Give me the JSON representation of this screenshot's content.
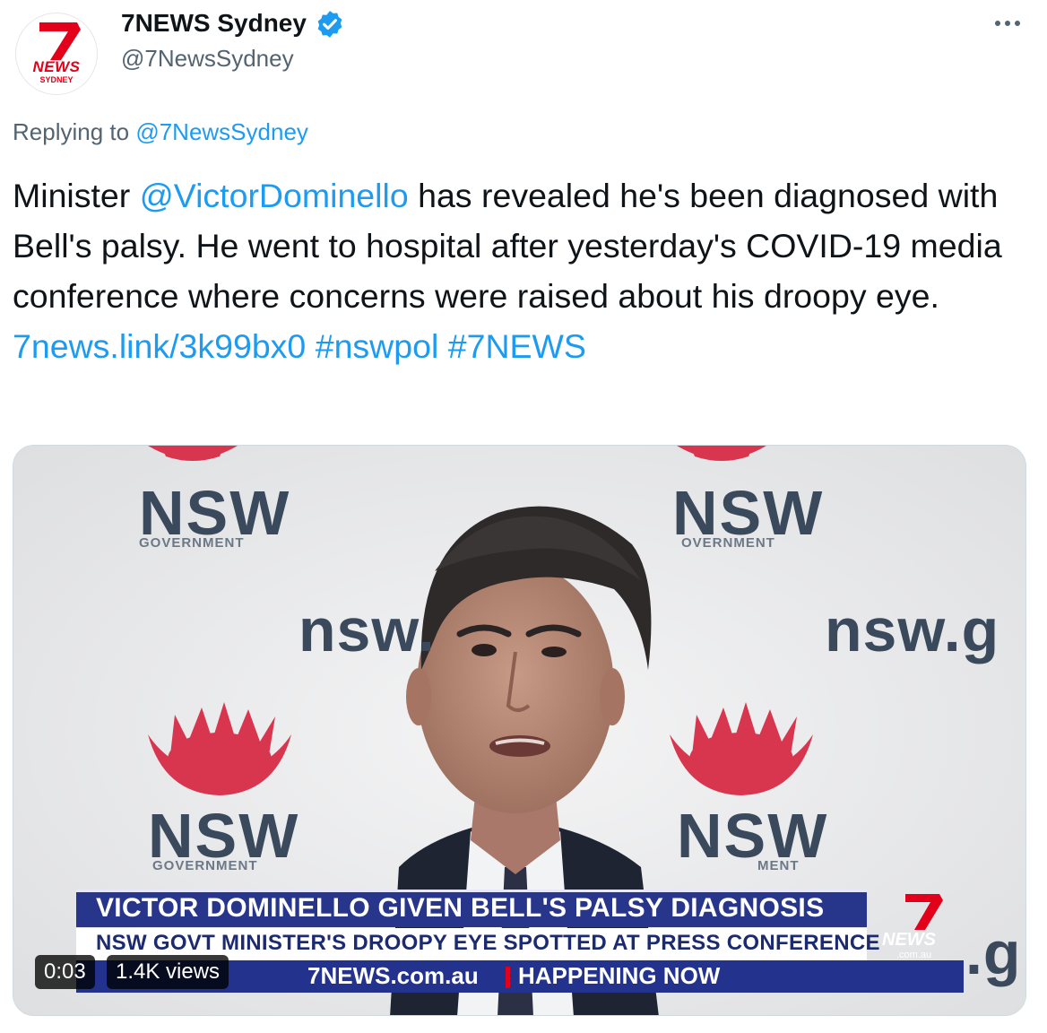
{
  "author": {
    "display_name": "7NEWS Sydney",
    "handle": "@7NewsSydney",
    "verified": true,
    "avatar": {
      "logo_number": "7",
      "logo_word": "NEWS",
      "logo_city": "SYDNEY"
    }
  },
  "menu": {
    "icon": "more-horizontal-icon"
  },
  "reply_context": {
    "prefix": "Replying to",
    "handle": "@7NewsSydney"
  },
  "tweet": {
    "text_part1": "Minister ",
    "mention": "@VictorDominello",
    "text_part2": " has revealed he's been diagnosed with Bell's palsy. He went to hospital after yesterday's COVID-19 media conference where concerns were raised about his droopy eye.",
    "link": "7news.link/3k99bx0",
    "hashtag1": "#nswpol",
    "hashtag2": "#7NEWS"
  },
  "video": {
    "backdrop": {
      "brand": "NSW",
      "brand_sub": "GOVERNMENT",
      "brand_sub_partial": "OVERNMENT",
      "brand_sub_partial2": "MENT",
      "url_left": "nsw.",
      "url_right": "nsw.g",
      "url_right_lower": ".g"
    },
    "headline": "VICTOR DOMINELLO GIVEN BELL'S PALSY DIAGNOSIS",
    "subheadline": "NSW GOVT MINISTER'S DROOPY EYE SPOTTED AT PRESS CONFERENCE",
    "ticker_site": "7NEWS.com.au",
    "ticker_label": "HAPPENING NOW",
    "channel_logo": {
      "number": "7",
      "word": "NEWS",
      "domain": ".com.au"
    },
    "time": "0:03",
    "views": "1.4K views"
  },
  "colors": {
    "link": "#1d9bf0",
    "secondary_text": "#536471",
    "brand_red": "#e2001a",
    "banner_blue": "#27358a"
  }
}
